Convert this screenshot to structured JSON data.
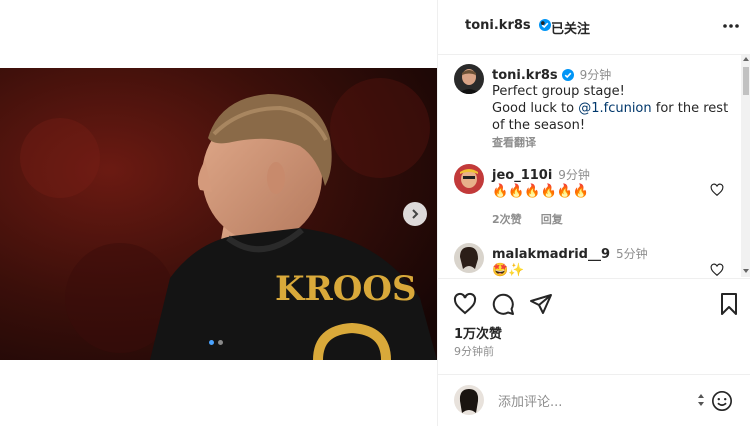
{
  "post": {
    "author": "toni.kr8s",
    "follow_status": "已关注",
    "separator": "•",
    "jersey_name": "KROOS",
    "likes": "1万次赞",
    "posted_ago": "9分钟前"
  },
  "caption": {
    "user": "toni.kr8s",
    "time": "9分钟",
    "line1": "Perfect group stage!",
    "line2_pre": "Good luck to ",
    "mention": "@1.fcunion",
    "line2_post": " for the rest",
    "line3": "of the season!",
    "translate": "查看翻译"
  },
  "comments": [
    {
      "user": "jeo_110i",
      "time": "9分钟",
      "text": "🔥🔥🔥🔥🔥🔥",
      "likes": "2次赞",
      "reply": "回复"
    },
    {
      "user": "malakmadrid__9",
      "time": "5分钟",
      "text": "🤩✨"
    }
  ],
  "composer": {
    "placeholder": "添加评论..."
  },
  "icons": [
    "verified-badge-icon",
    "more-options-icon",
    "heart-icon",
    "comment-icon",
    "share-icon",
    "bookmark-icon",
    "emoji-icon",
    "chevron-right-icon"
  ],
  "colors": {
    "verified": "#0095f6",
    "mention": "#00376b",
    "muted": "#8e8e8e",
    "jersey_gold": "#d9a93a"
  }
}
